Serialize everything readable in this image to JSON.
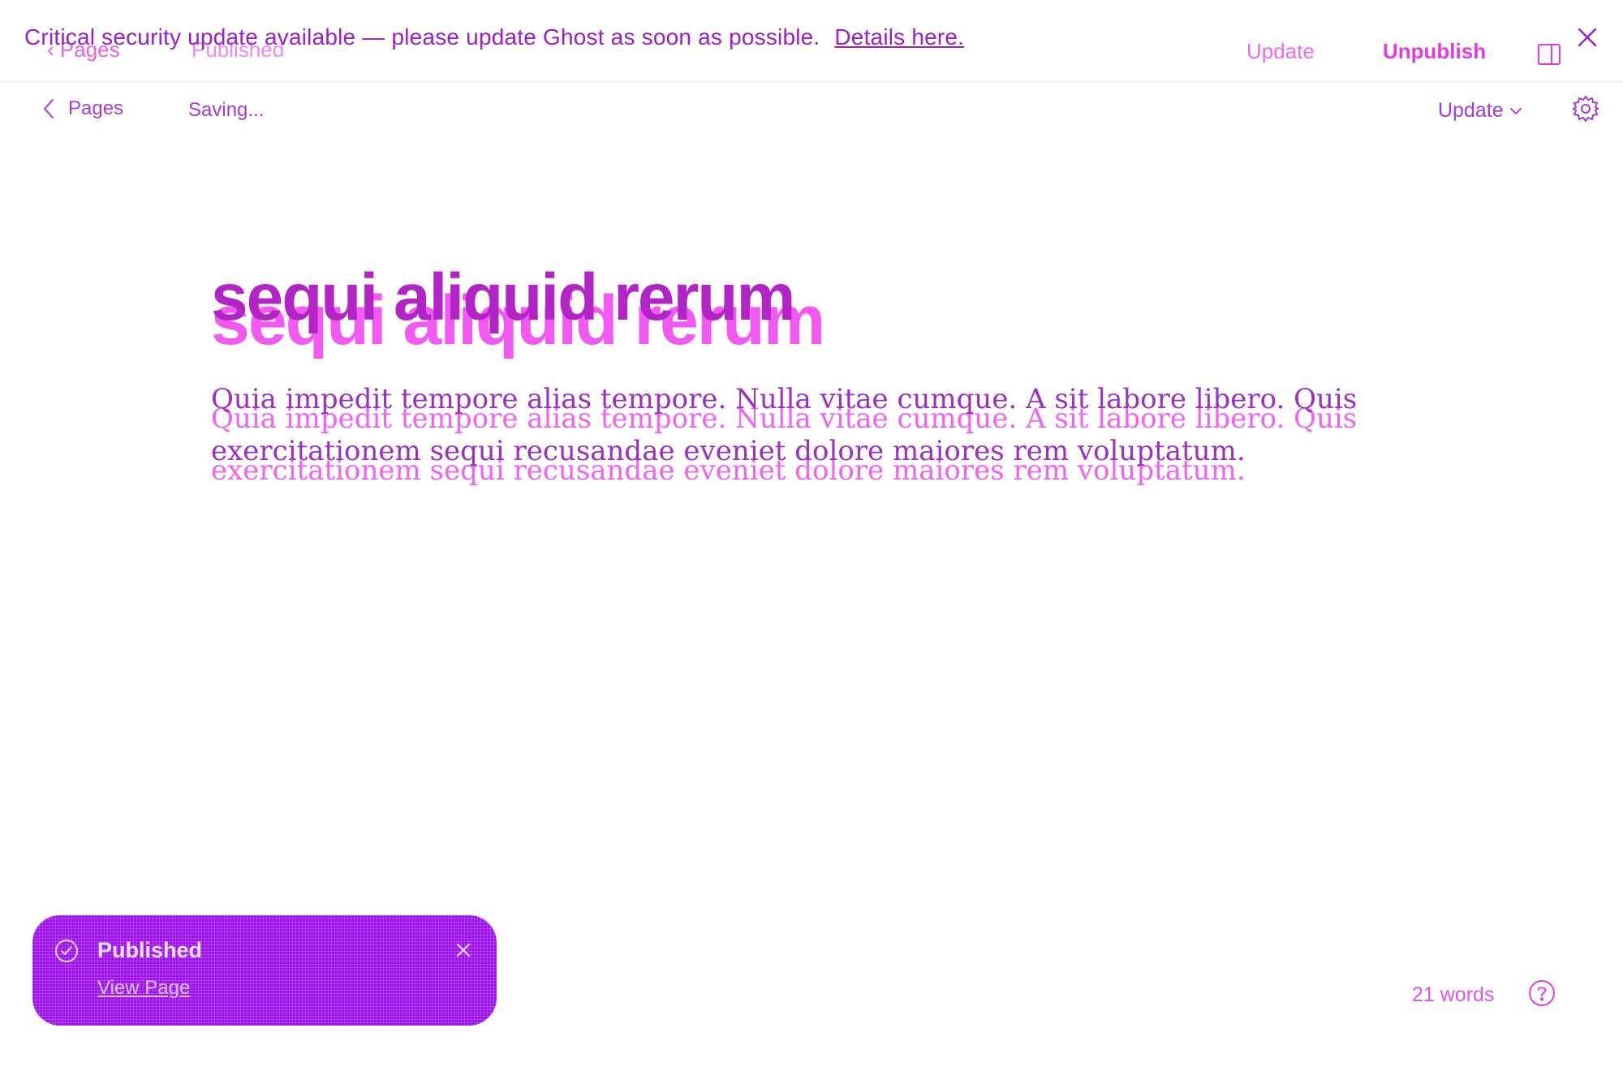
{
  "banner": {
    "message": "Critical security update available — please update Ghost as soon as possible.",
    "link_text": "Details here.",
    "close_icon": "close-icon"
  },
  "ghost_header": {
    "back_label": "Pages",
    "status": "Published",
    "update_label": "Update",
    "unpublish_label": "Unpublish",
    "sidebar_icon": "sidebar-toggle-icon"
  },
  "editor_header": {
    "back_label": "Pages",
    "status": "Saving...",
    "update_label": "Update",
    "settings_icon": "gear-icon"
  },
  "content": {
    "title": "sequi aliquid rerum",
    "body": "Quia impedit tempore alias tempore. Nulla vitae cumque. A sit labore libero. Quis exercitationem sequi recusandae eveniet dolore maiores rem voluptatum."
  },
  "toast": {
    "title": "Published",
    "link_text": "View Page",
    "icon": "check-circle-icon",
    "close_icon": "close-icon"
  },
  "footer": {
    "word_count": "21 words",
    "help_icon": "help-icon"
  },
  "colors": {
    "accent": "#9a1fc8",
    "ghost": "#f03cf0",
    "toast_bg": "#9d10f0"
  }
}
